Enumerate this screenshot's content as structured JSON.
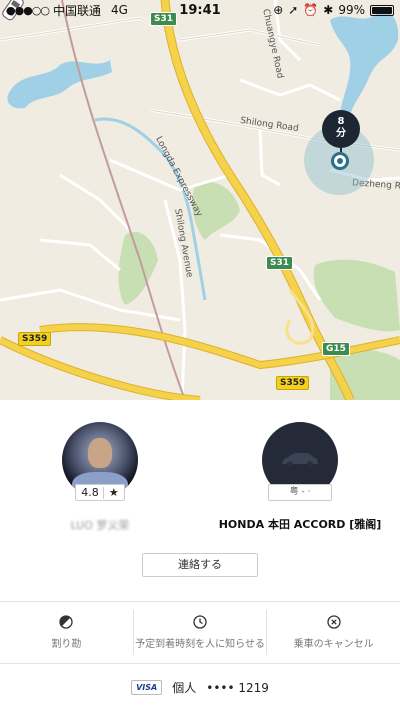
{
  "status_bar": {
    "carrier": "中国联通",
    "network": "4G",
    "time": "19:41",
    "battery": "99%",
    "battery_level": 0.99
  },
  "map": {
    "road_labels": {
      "longda": "Longda Expressway",
      "shilong_road": "Shilong Road",
      "shilong_avenue": "Shilong Avenue",
      "chuangye": "Chuangye Road",
      "dezheng": "Dezheng R"
    },
    "shields": {
      "s31_top": "S31",
      "s31_mid": "S31",
      "g15": "G15",
      "s359_left": "S359",
      "s359_bottom": "S359"
    },
    "eta": {
      "value": "8",
      "unit": "分"
    },
    "colors": {
      "expressway": "#f5d24b",
      "water": "#9fd0e6",
      "park": "#c8dfb4",
      "land": "#f1ece2"
    }
  },
  "driver": {
    "rating": "4.8",
    "rating_icon": "star-icon",
    "name": "LUO 罗义荣"
  },
  "vehicle": {
    "plate": "粤 -  ·",
    "name": "HONDA 本田 ACCORD [雅阁]"
  },
  "contact_button": "連絡する",
  "actions": [
    {
      "icon": "split-fare-icon",
      "label": "割り勘"
    },
    {
      "icon": "clock-icon",
      "label": "予定到着時刻を人に知らせる"
    },
    {
      "icon": "cancel-icon",
      "label": "乗車のキャンセル"
    }
  ],
  "payment": {
    "card_brand": "VISA",
    "profile": "個人",
    "card_masked": "•••• 1219"
  }
}
